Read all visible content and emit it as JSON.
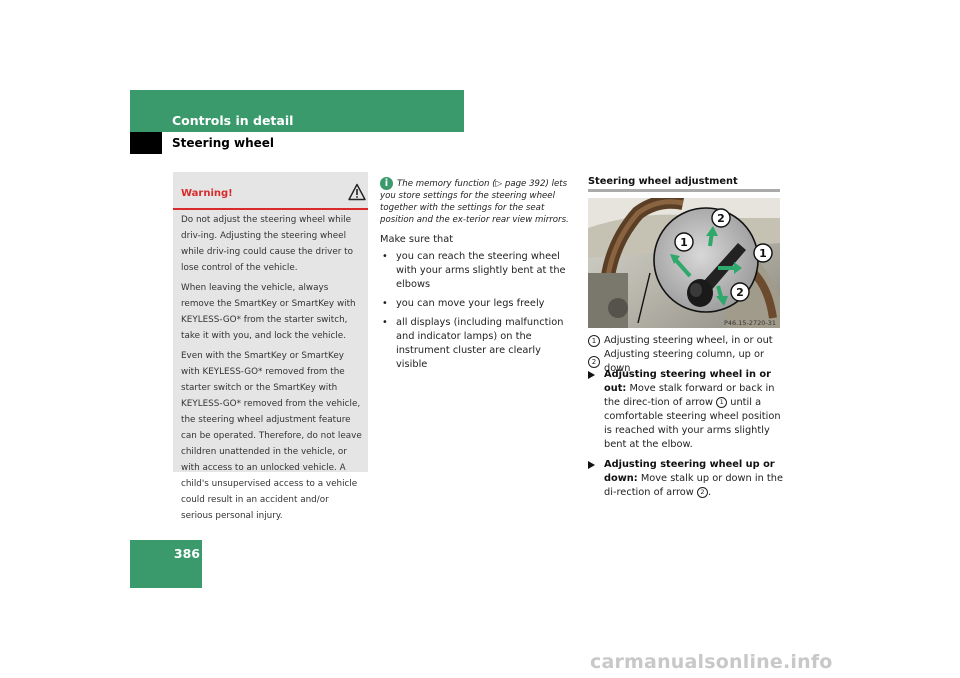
{
  "header": {
    "section": "Controls in detail",
    "subsection": "Steering wheel"
  },
  "page_number": "386",
  "warning": {
    "title": "Warning!",
    "paragraphs": [
      "Do not adjust the steering wheel while driv-ing. Adjusting the steering wheel while driv-ing could cause the driver to lose control of the vehicle.",
      "When leaving the vehicle, always remove the SmartKey or SmartKey with KEYLESS-GO* from the starter switch, take it with you, and lock the vehicle.",
      "Even with the SmartKey or SmartKey with KEYLESS-GO* removed from the starter switch or the SmartKey with KEYLESS-GO* removed from the vehicle, the steering wheel adjustment feature can be operated. Therefore, do not leave children unattended in the vehicle, or with access to an unlocked vehicle. A child's unsupervised access to a vehicle could result in an accident and/or serious personal injury."
    ]
  },
  "info": {
    "icon": "i",
    "text": "The memory function (▷ page 392) lets you store settings for the steering wheel together with the settings for the seat position and the ex-terior rear view mirrors."
  },
  "make_sure": {
    "intro": "Make sure that",
    "bullets": [
      "you can reach the steering wheel with your arms slightly bent at the elbows",
      "you can move your legs freely",
      "all displays (including malfunction and indicator lamps) on the instrument cluster are clearly visible"
    ]
  },
  "adjustment": {
    "title": "Steering wheel adjustment",
    "image_code": "P46.15-2720-31",
    "callout_1": "1",
    "callout_2": "2",
    "captions": [
      {
        "num": "1",
        "text": "Adjusting steering wheel, in or out"
      },
      {
        "num": "2",
        "text": "Adjusting steering column, up or down"
      }
    ],
    "step1": {
      "bold": "Adjusting steering wheel in or out:",
      "text_a": "Move stalk forward or back in the direc-tion of arrow",
      "num": "1",
      "text_b": "until a comfortable steering wheel position is reached with your arms slightly bent at the elbow."
    },
    "step2": {
      "bold": "Adjusting steering wheel up or down:",
      "text_a": "Move stalk up or down in the di-rection of arrow",
      "num": "2",
      "text_b": "."
    }
  },
  "watermark": "carmanualsonline.info",
  "colors": {
    "accent": "#3a9a6c",
    "warning": "#d92b2b",
    "box": "#e5e5e5"
  }
}
